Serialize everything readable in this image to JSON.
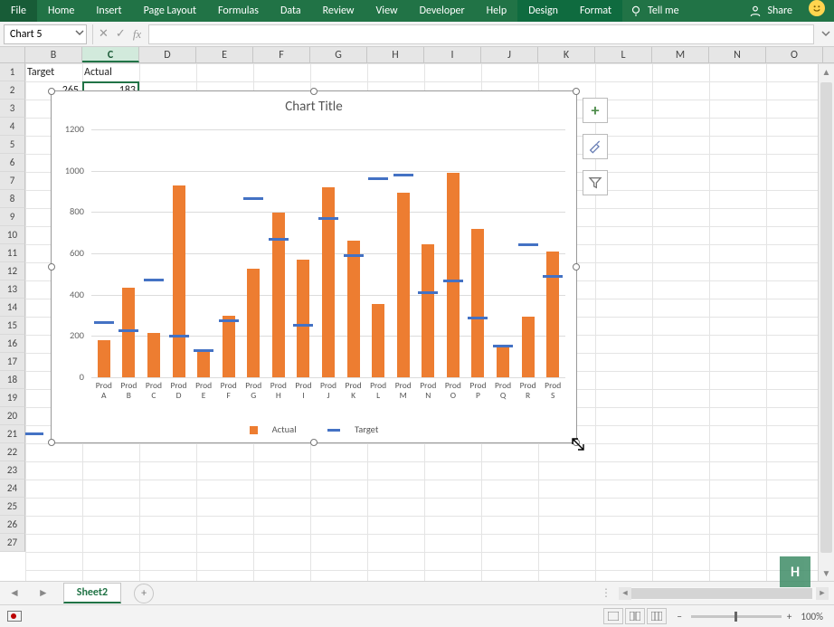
{
  "ribbon": {
    "tabs": [
      "File",
      "Home",
      "Insert",
      "Page Layout",
      "Formulas",
      "Data",
      "Review",
      "View",
      "Developer",
      "Help",
      "Design",
      "Format"
    ],
    "tellme": "Tell me",
    "share": "Share"
  },
  "namebox": "Chart 5",
  "columns": [
    "B",
    "C",
    "D",
    "E",
    "F",
    "G",
    "H",
    "I",
    "J",
    "K",
    "L",
    "M",
    "N",
    "O"
  ],
  "selected_col_index": 1,
  "row_count": 27,
  "cells": {
    "B1": "Target",
    "C1": "Actual",
    "B2": "265",
    "C2": "183"
  },
  "chart_buttons": [
    "plus",
    "brush",
    "filter"
  ],
  "sheet": {
    "active": "Sheet2"
  },
  "status": {
    "zoom": "100%"
  },
  "watermark": "H",
  "chart_data": {
    "type": "bar",
    "title": "Chart Title",
    "ylim": [
      0,
      1200
    ],
    "yticks": [
      0,
      200,
      400,
      600,
      800,
      1000,
      1200
    ],
    "categories": [
      "Prod A",
      "Prod B",
      "Prod C",
      "Prod D",
      "Prod E",
      "Prod F",
      "Prod G",
      "Prod H",
      "Prod I",
      "Prod J",
      "Prod K",
      "Prod L",
      "Prod M",
      "Prod N",
      "Prod O",
      "Prod P",
      "Prod Q",
      "Prod R",
      "Prod S"
    ],
    "series": [
      {
        "name": "Actual",
        "type": "bar",
        "color": "#ed7d31",
        "values": [
          180,
          435,
          215,
          930,
          135,
          300,
          525,
          795,
          570,
          920,
          660,
          355,
          895,
          645,
          990,
          720,
          155,
          295,
          610
        ]
      },
      {
        "name": "Target",
        "type": "marker",
        "color": "#4472c4",
        "values": [
          265,
          225,
          470,
          200,
          130,
          275,
          865,
          670,
          250,
          770,
          590,
          960,
          980,
          410,
          465,
          285,
          150,
          640,
          490
        ]
      }
    ],
    "legend": [
      "Actual",
      "Target"
    ]
  }
}
